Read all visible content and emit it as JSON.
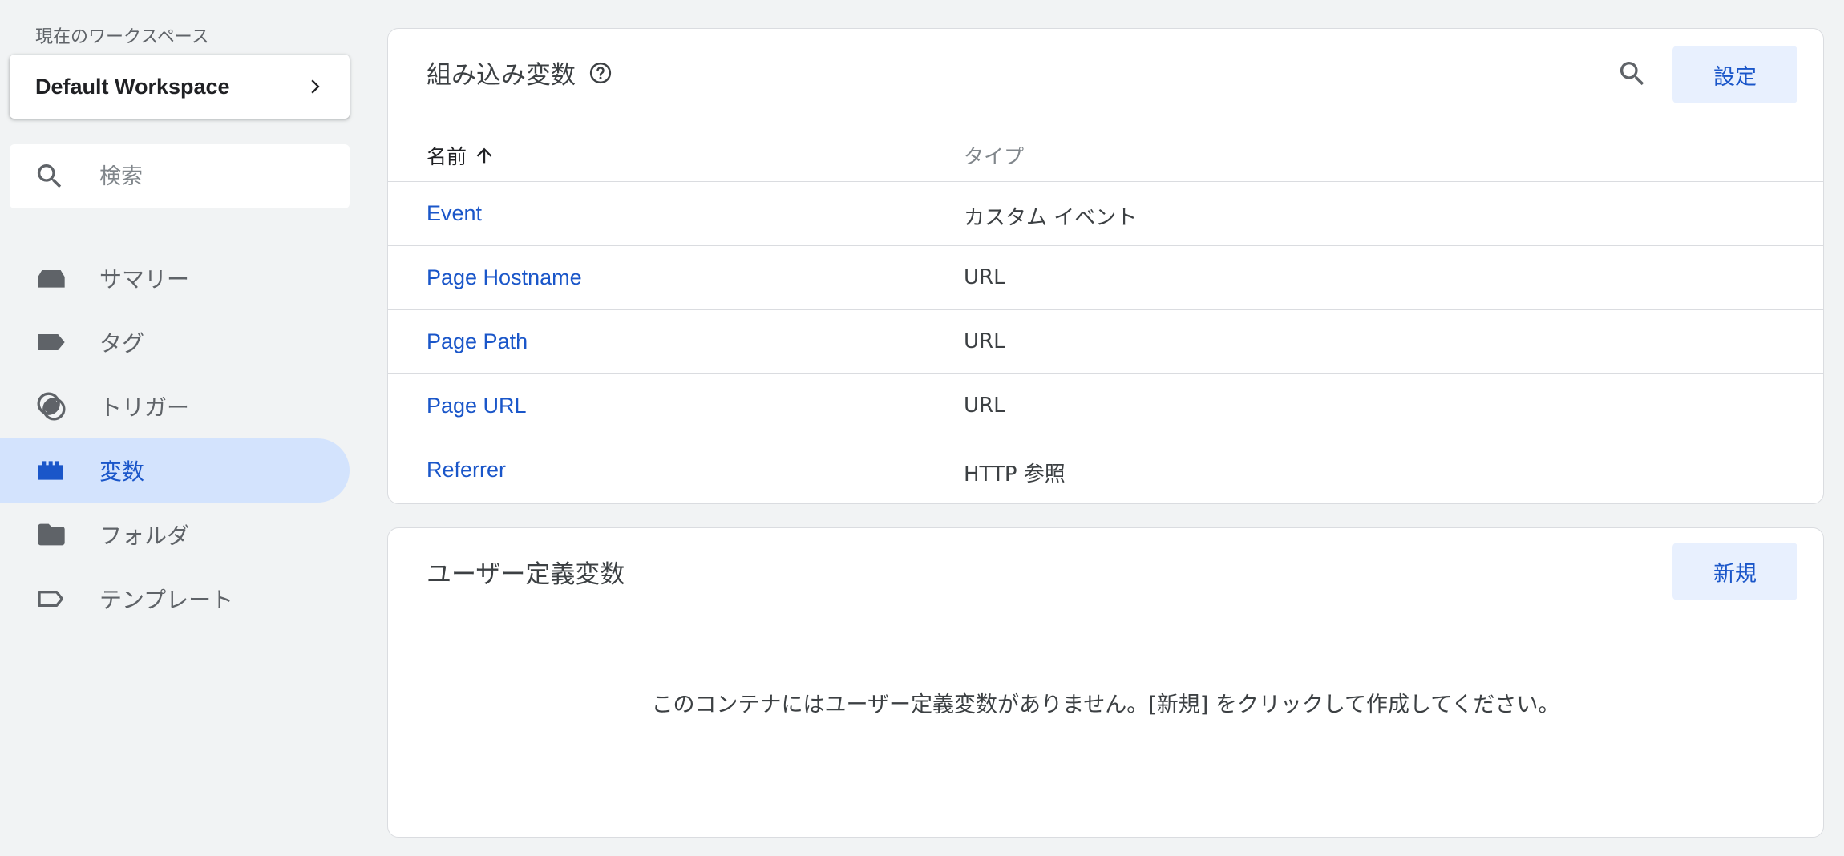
{
  "sidebar": {
    "workspace_label": "現在のワークスペース",
    "workspace_name": "Default Workspace",
    "search_placeholder": "検索",
    "items": [
      {
        "label": "サマリー",
        "icon": "summary-icon"
      },
      {
        "label": "タグ",
        "icon": "tag-icon"
      },
      {
        "label": "トリガー",
        "icon": "trigger-icon"
      },
      {
        "label": "変数",
        "icon": "variables-icon",
        "active": true
      },
      {
        "label": "フォルダ",
        "icon": "folder-icon"
      },
      {
        "label": "テンプレート",
        "icon": "template-icon"
      }
    ]
  },
  "builtin": {
    "title": "組み込み変数",
    "configure_label": "設定",
    "columns": {
      "name": "名前",
      "type": "タイプ"
    },
    "rows": [
      {
        "name": "Event",
        "type": "カスタム イベント"
      },
      {
        "name": "Page Hostname",
        "type": "URL"
      },
      {
        "name": "Page Path",
        "type": "URL"
      },
      {
        "name": "Page URL",
        "type": "URL"
      },
      {
        "name": "Referrer",
        "type": "HTTP 参照"
      }
    ]
  },
  "userdef": {
    "title": "ユーザー定義変数",
    "new_label": "新規",
    "empty_message": "このコンテナにはユーザー定義変数がありません。[新規] をクリックして作成してください。"
  },
  "colors": {
    "accent": "#1a56c9",
    "active_bg": "#d3e3fd",
    "page_bg": "#f1f3f4"
  }
}
